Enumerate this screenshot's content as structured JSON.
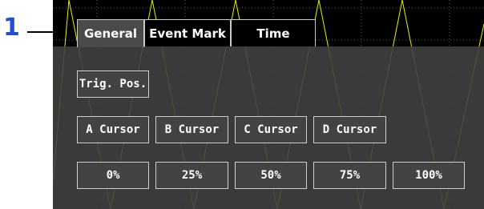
{
  "callout": {
    "number": "1"
  },
  "tabs": [
    {
      "label": "General",
      "active": true
    },
    {
      "label": "Event Mark",
      "active": false
    },
    {
      "label": "Time",
      "active": false
    }
  ],
  "buttons": {
    "trig_pos": "Trig. Pos.",
    "cursors": [
      "A Cursor",
      "B Cursor",
      "C Cursor",
      "D Cursor"
    ],
    "positions": [
      "0%",
      "25%",
      "50%",
      "75%",
      "100%"
    ]
  },
  "colors": {
    "callout": "#1f4fd8",
    "screen_bg": "#000000",
    "panel_bg": "#404040",
    "waveform": "#e6f000",
    "border": "#cfcfcf"
  }
}
